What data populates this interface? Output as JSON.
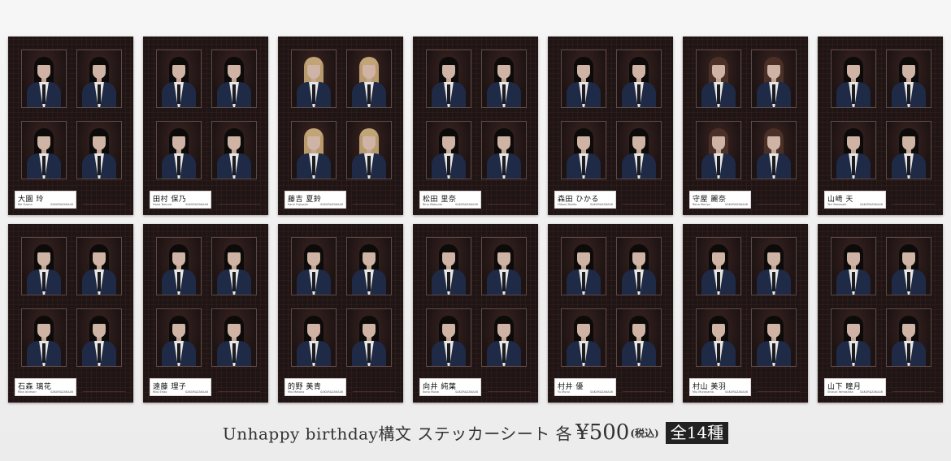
{
  "sheets": [
    {
      "name": "大園 玲",
      "romaji": "Rei Ozono",
      "group": "SAKURAZAKA46",
      "hair": "black"
    },
    {
      "name": "田村 保乃",
      "romaji": "Hono Tamura",
      "group": "SAKURAZAKA46",
      "hair": "black"
    },
    {
      "name": "藤吉 夏鈴",
      "romaji": "Karin Fujiyoshi",
      "group": "SAKURAZAKA46",
      "hair": "blonde"
    },
    {
      "name": "松田 里奈",
      "romaji": "Rina Matsuda",
      "group": "SAKURAZAKA46",
      "hair": "black"
    },
    {
      "name": "森田 ひかる",
      "romaji": "Hikaru Morita",
      "group": "SAKURAZAKA46",
      "hair": "black"
    },
    {
      "name": "守屋 麗奈",
      "romaji": "Rena Moriya",
      "group": "SAKURAZAKA46",
      "hair": "brown"
    },
    {
      "name": "山﨑 天",
      "romaji": "Ten Yamasaki",
      "group": "SAKURAZAKA46",
      "hair": "black"
    },
    {
      "name": "石森 璃花",
      "romaji": "Rika Ishimori",
      "group": "SAKURAZAKA46",
      "hair": "black"
    },
    {
      "name": "遠藤 理子",
      "romaji": "Riko Endo",
      "group": "SAKURAZAKA46",
      "hair": "black"
    },
    {
      "name": "的野 美青",
      "romaji": "Mio Matono",
      "group": "SAKURAZAKA46",
      "hair": "black"
    },
    {
      "name": "向井 純葉",
      "romaji": "Itoha Mukai",
      "group": "SAKURAZAKA46",
      "hair": "black"
    },
    {
      "name": "村井 優",
      "romaji": "Yu Murai",
      "group": "SAKURAZAKA46",
      "hair": "black"
    },
    {
      "name": "村山 美羽",
      "romaji": "Miu Murayama",
      "group": "SAKURAZAKA46",
      "hair": "black"
    },
    {
      "name": "山下 瞳月",
      "romaji": "Shizuki Yamashita",
      "group": "SAKURAZAKA46",
      "hair": "black"
    }
  ],
  "caption": {
    "main": "Unhappy birthday構文 ステッカーシート 各",
    "price": "¥500",
    "tax": "(税込)",
    "badge": "全14種"
  }
}
